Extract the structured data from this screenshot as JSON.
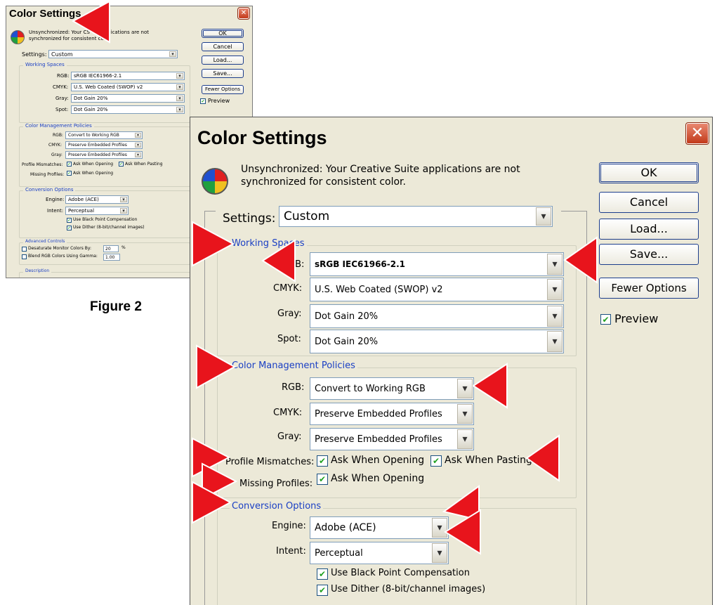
{
  "window": {
    "title": "Color Settings",
    "close_label": "✕"
  },
  "info": {
    "line1": "Unsynchronized: Your Creative Suite applications are not",
    "line2": "synchronized for consistent color."
  },
  "small_info": {
    "line1": "Unsynchronized: Your CS",
    "line1b": "e applications are not",
    "line2": "synchronized for consistent co"
  },
  "buttons": {
    "ok": "OK",
    "cancel": "Cancel",
    "load": "Load...",
    "save": "Save...",
    "fewer": "Fewer Options"
  },
  "preview": {
    "label": "Preview",
    "checked": true
  },
  "settings": {
    "label": "Settings:",
    "value": "Custom"
  },
  "working_spaces": {
    "title": "Working Spaces",
    "rgb_label": "RGB:",
    "rgb_value": "sRGB IEC61966-2.1",
    "cmyk_label": "CMYK:",
    "cmyk_value": "U.S. Web Coated (SWOP) v2",
    "gray_label": "Gray:",
    "gray_value": "Dot Gain 20%",
    "spot_label": "Spot:",
    "spot_value": "Dot Gain 20%"
  },
  "policies": {
    "title": "Color Management Policies",
    "rgb_label": "RGB:",
    "rgb_value": "Convert to Working RGB",
    "cmyk_label": "CMYK:",
    "cmyk_value": "Preserve Embedded Profiles",
    "gray_label": "Gray:",
    "gray_value": "Preserve Embedded Profiles",
    "mismatch_label": "Profile Mismatches:",
    "ask_opening": "Ask When Opening",
    "ask_pasting": "Ask When Pasting",
    "missing_label": "Missing Profiles:",
    "missing_ask_opening": "Ask When Opening"
  },
  "conversion": {
    "title": "Conversion Options",
    "engine_label": "Engine:",
    "engine_value": "Adobe (ACE)",
    "intent_label": "Intent:",
    "intent_value": "Perceptual",
    "black_point": "Use Black Point Compensation",
    "dither": "Use Dither (8-bit/channel images)"
  },
  "advanced": {
    "title": "Advanced Controls",
    "desaturate": "Desaturate Monitor Colors By:",
    "desaturate_value": "20",
    "desaturate_unit": "%",
    "blend": "Blend RGB Colors Using Gamma:",
    "blend_value": "1.00"
  },
  "description": {
    "title": "Description"
  },
  "caption": "Figure 2",
  "icons": {
    "check": "✔",
    "dropdown": "▾"
  },
  "colors": {
    "annotation_red": "#e8141c",
    "group_label_blue": "#1a3fc4",
    "dialog_bg": "#ece9d8"
  }
}
